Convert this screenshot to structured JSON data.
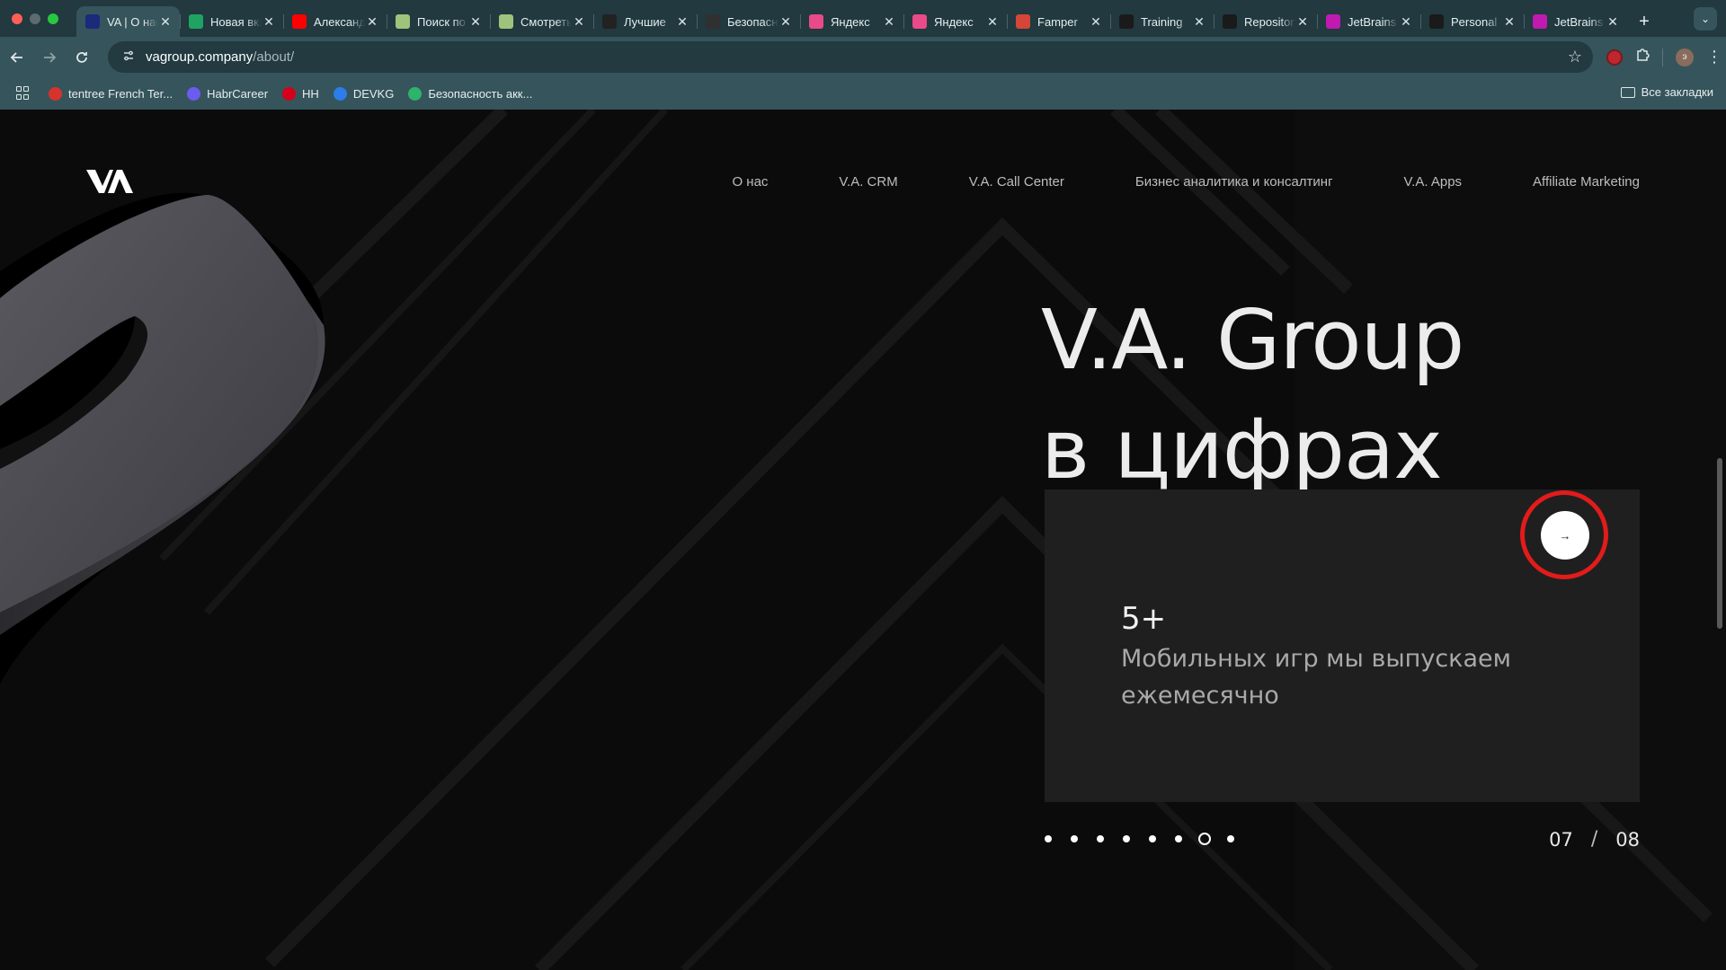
{
  "browser": {
    "tabs": [
      {
        "title": "VA | О нас",
        "favicon": "va-logo-icon",
        "color": "#1b2a7a",
        "active": true
      },
      {
        "title": "Новая вкладка",
        "favicon": "google-sheets-icon",
        "color": "#1ea362",
        "active": false
      },
      {
        "title": "Александр",
        "favicon": "youtube-icon",
        "color": "#ff0000",
        "active": false
      },
      {
        "title": "Поиск по",
        "favicon": "chat-gpt-icon",
        "color": "#9fc37a",
        "active": false
      },
      {
        "title": "Смотреть",
        "favicon": "chat-gpt-icon",
        "color": "#9fc37a",
        "active": false
      },
      {
        "title": "Лучшие",
        "favicon": "kp-icon",
        "color": "#222222",
        "active": false
      },
      {
        "title": "Безопасность",
        "favicon": "yandex-id-icon",
        "color": "#303030",
        "active": false
      },
      {
        "title": "Яндекс",
        "favicon": "yandex-icon",
        "color": "#e84a8a",
        "active": false
      },
      {
        "title": "Яндекс",
        "favicon": "yandex-icon",
        "color": "#e84a8a",
        "active": false
      },
      {
        "title": "Famper",
        "favicon": "gmail-icon",
        "color": "#d44638",
        "active": false
      },
      {
        "title": "Training",
        "favicon": "github-icon",
        "color": "#1a1a1a",
        "active": false
      },
      {
        "title": "Repository",
        "favicon": "github-icon",
        "color": "#1a1a1a",
        "active": false
      },
      {
        "title": "JetBrains",
        "favicon": "jetbrains-icon",
        "color": "#c01ab0",
        "active": false
      },
      {
        "title": "Personal",
        "favicon": "github-icon",
        "color": "#1a1a1a",
        "active": false
      },
      {
        "title": "JetBrains",
        "favicon": "jetbrains-icon",
        "color": "#c01ab0",
        "active": false
      }
    ],
    "new_tab_label": "+",
    "url_host": "vagroup.company",
    "url_path": "/about/",
    "avatar_letter": "э",
    "bookmarks": [
      {
        "label": "tentree French Ter...",
        "favicon": "tentree-icon",
        "color": "#d8322c"
      },
      {
        "label": "HabrCareer",
        "favicon": "habr-career-icon",
        "color": "#6b5cf0"
      },
      {
        "label": "HH",
        "favicon": "hh-icon",
        "color": "#d6001c"
      },
      {
        "label": "DEVKG",
        "favicon": "devkg-icon",
        "color": "#2b7de9"
      },
      {
        "label": "Безопасность акк...",
        "favicon": "shield-icon",
        "color": "#2db36a"
      }
    ],
    "all_bookmarks_label": "Все закладки"
  },
  "site": {
    "nav": [
      {
        "label": "О нас"
      },
      {
        "label": "V.A. CRM"
      },
      {
        "label": "V.A. Call Center"
      },
      {
        "label": "Бизнес аналитика и консалтинг"
      },
      {
        "label": "V.A. Apps"
      },
      {
        "label": "Affiliate Marketing"
      }
    ],
    "hero_line1": "V.A. Group",
    "hero_line2": "в цифрах",
    "slide": {
      "number": "5+",
      "text": "Мобильных игр мы выпускаем ежемесячно",
      "next_label": "→"
    },
    "slider": {
      "dot_count": 8,
      "current_index": 7,
      "current": "07",
      "separator": "/",
      "total": "08"
    }
  }
}
